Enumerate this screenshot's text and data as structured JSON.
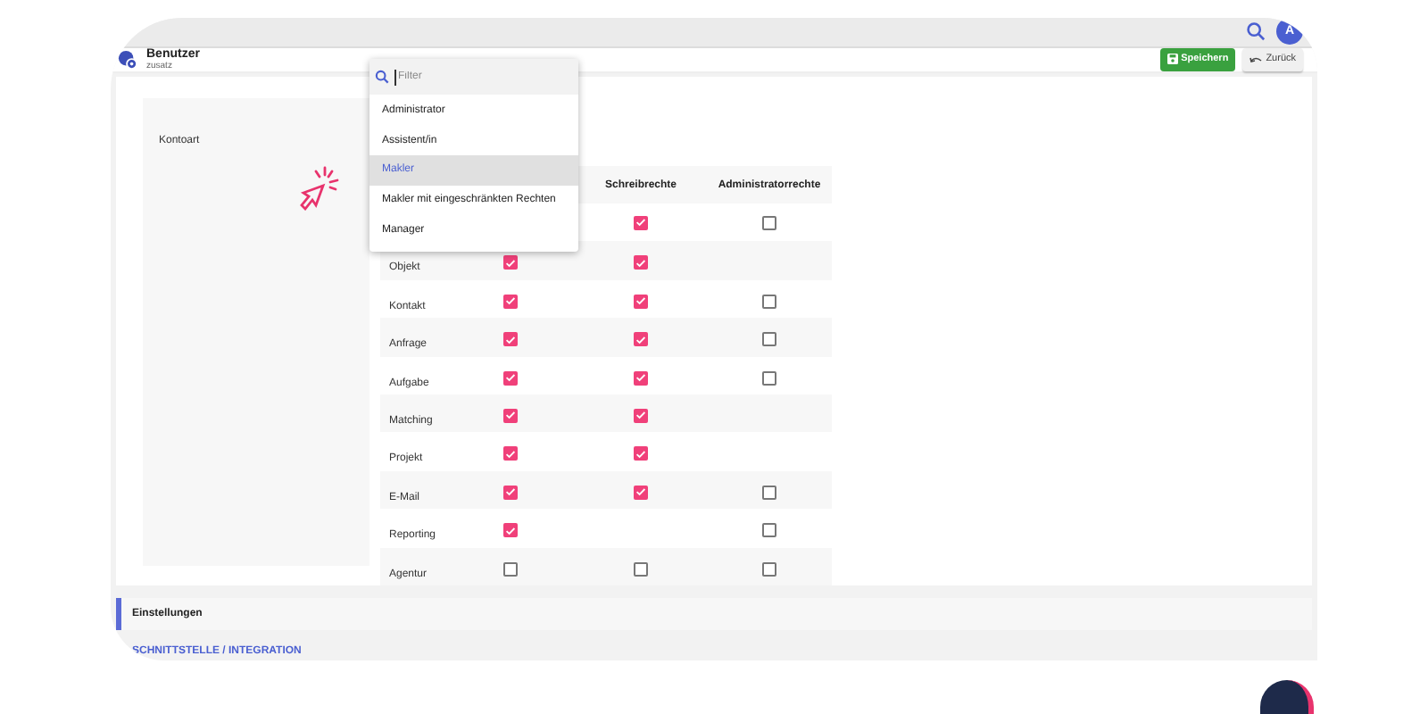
{
  "header": {
    "title": "Benutzer",
    "subtitle": "zusatz",
    "buttons": [
      {
        "kind": "save",
        "label": "Speichern"
      },
      {
        "kind": "back",
        "label": "Zurück"
      }
    ]
  },
  "avatar": {
    "initial": "A"
  },
  "section": {
    "label": "Kontoart"
  },
  "table": {
    "columns": [
      "Schreibrechte",
      "Administratorrechte"
    ],
    "rows": [
      {
        "cells": [
          null,
          {
            "checked": true
          },
          {
            "checked": false
          }
        ]
      },
      {
        "label": "Objekt",
        "cells": [
          {
            "checked": true
          },
          {
            "checked": true
          },
          null
        ]
      },
      {
        "label": "Kontakt",
        "cells": [
          {
            "checked": true
          },
          {
            "checked": true
          },
          {
            "checked": false
          }
        ]
      },
      {
        "label": "Anfrage",
        "cells": [
          {
            "checked": true
          },
          {
            "checked": true
          },
          {
            "checked": false
          }
        ]
      },
      {
        "label": "Aufgabe",
        "cells": [
          {
            "checked": true
          },
          {
            "checked": true
          },
          {
            "checked": false
          }
        ]
      },
      {
        "label": "Matching",
        "cells": [
          {
            "checked": true
          },
          {
            "checked": true
          },
          null
        ]
      },
      {
        "label": "Projekt",
        "cells": [
          {
            "checked": true
          },
          {
            "checked": true
          },
          null
        ]
      },
      {
        "label": "E-Mail",
        "cells": [
          {
            "checked": true
          },
          {
            "checked": true
          },
          {
            "checked": false
          }
        ]
      },
      {
        "label": "Reporting",
        "cells": [
          {
            "checked": true
          },
          null,
          {
            "checked": false
          }
        ]
      },
      {
        "label": "Agentur",
        "cells": [
          {
            "checked": false
          },
          {
            "checked": false
          },
          {
            "checked": false
          }
        ]
      }
    ]
  },
  "dropdown": {
    "placeholder": "Filter",
    "options": [
      {
        "label": "Administrator",
        "selected": false
      },
      {
        "label": "Assistent/in",
        "selected": false
      },
      {
        "label": "Makler",
        "selected": true
      },
      {
        "label": "Makler mit eingeschränkten Rechten",
        "selected": false
      },
      {
        "label": "Manager",
        "selected": false
      }
    ]
  },
  "settings": {
    "label": "Einstellungen"
  },
  "link": {
    "label": "SCHNITTSTELLE / INTEGRATION"
  }
}
